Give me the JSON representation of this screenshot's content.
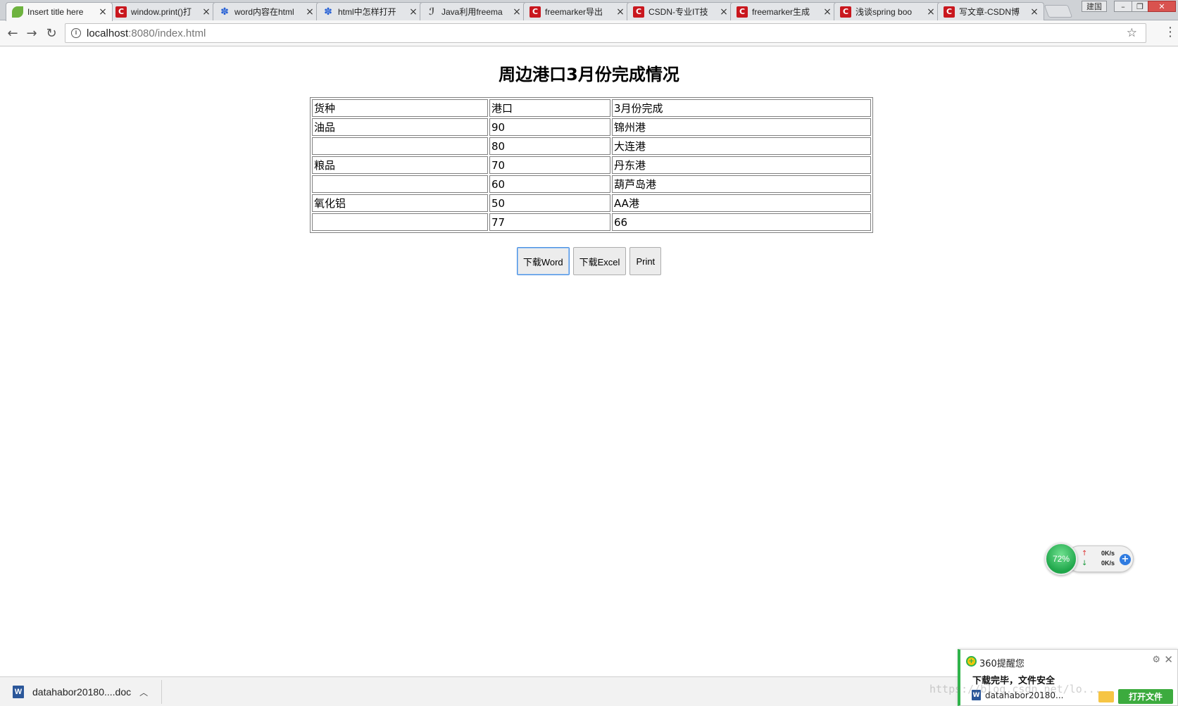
{
  "browser": {
    "tabs": [
      {
        "label": "Insert title here",
        "icon": "leaf-icon"
      },
      {
        "label": "window.print()打",
        "icon": "csdn-icon"
      },
      {
        "label": "word内容在html",
        "icon": "baidu-icon"
      },
      {
        "label": "html中怎样打开",
        "icon": "baidu-icon"
      },
      {
        "label": "Java利用freema",
        "icon": "java-icon"
      },
      {
        "label": "freemarker导出",
        "icon": "csdn-icon"
      },
      {
        "label": "CSDN-专业IT技",
        "icon": "csdn-icon"
      },
      {
        "label": "freemarker生成",
        "icon": "csdn-icon"
      },
      {
        "label": "浅谈spring boo",
        "icon": "csdn-icon"
      },
      {
        "label": "写文章-CSDN博",
        "icon": "csdn-icon"
      }
    ],
    "window_label": "建国",
    "url_host": "localhost",
    "url_rest": ":8080/index.html"
  },
  "page": {
    "title": "周边港口3月份完成情况",
    "table": {
      "rows": [
        [
          "货种",
          "港口",
          "3月份完成"
        ],
        [
          "油品",
          "90",
          "锦州港"
        ],
        [
          "",
          "80",
          "大连港"
        ],
        [
          "粮品",
          "70",
          "丹东港"
        ],
        [
          "",
          "60",
          "葫芦岛港"
        ],
        [
          "氧化铝",
          "50",
          "AA港"
        ],
        [
          "",
          "77",
          "66"
        ]
      ]
    },
    "buttons": {
      "word": "下载Word",
      "excel": "下载Excel",
      "print": "Print"
    }
  },
  "net_widget": {
    "percent": "72%",
    "up_rate": "0K/s",
    "down_rate": "0K/s"
  },
  "download_bar": {
    "filename": "datahabor20180....doc"
  },
  "popup_360": {
    "title": "360提醒您",
    "message": "下载完毕，文件安全",
    "filename": "datahabor20180...",
    "open_button": "打开文件"
  },
  "watermark": "https://blog.csdn.net/lo..."
}
